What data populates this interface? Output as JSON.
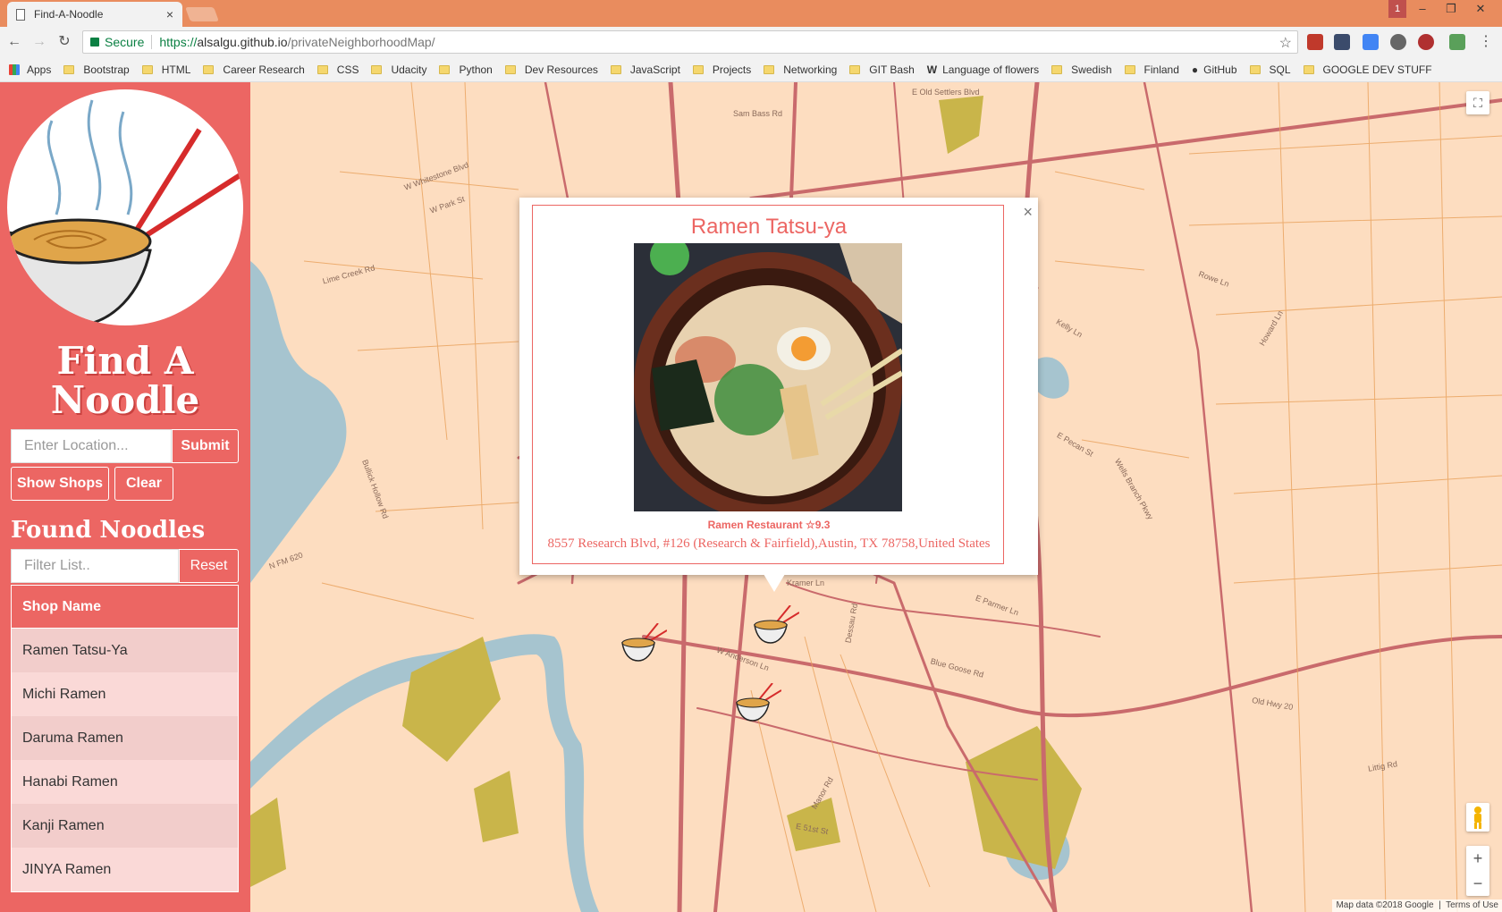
{
  "browser": {
    "tab_title": "Find-A-Noodle",
    "tab_close": "×",
    "window_badge": "1",
    "secure_label": "Secure",
    "url_scheme": "https://",
    "url_host": "alsalgu.github.io",
    "url_path": "/privateNeighborhoodMap/",
    "bookmarks": [
      "Apps",
      "Bootstrap",
      "HTML",
      "Career Research",
      "CSS",
      "Udacity",
      "Python",
      "Dev Resources",
      "JavaScript",
      "Projects",
      "Networking",
      "GIT Bash",
      "Language of flowers",
      "Swedish",
      "Finland",
      "GitHub",
      "SQL",
      "GOOGLE DEV STUFF"
    ]
  },
  "sidebar": {
    "title_line1": "Find A",
    "title_line2": "Noodle",
    "location_placeholder": "Enter Location...",
    "submit_label": "Submit",
    "show_shops_label": "Show Shops",
    "clear_label": "Clear",
    "found_title": "Found Noodles",
    "filter_placeholder": "Filter List..",
    "reset_label": "Reset",
    "table_header": "Shop Name",
    "shops": [
      "Ramen Tatsu-Ya",
      "Michi Ramen",
      "Daruma Ramen",
      "Hanabi Ramen",
      "Kanji Ramen",
      "JINYA Ramen"
    ]
  },
  "map": {
    "attribution_data": "Map data ©2018 Google",
    "attribution_terms": "Terms of Use",
    "zoom_in": "+",
    "zoom_out": "−",
    "road_labels": [
      "E Old Settlers Blvd",
      "Sam Bass Rd",
      "W Whitestone Blvd",
      "W Park St",
      "Lime Creek Rd",
      "Kramer Ln",
      "W Anderson Ln",
      "Dessau Rd",
      "Blue Goose Rd",
      "Old Hwy 20",
      "Rowe Ln",
      "Kelly Ln",
      "E Pecan St",
      "N FM 620",
      "Bullick Hollow Rd",
      "E 51st St",
      "Littig Rd",
      "E Parmer Ln",
      "Howard Ln",
      "Wells Branch Pkwy",
      "Manor Rd"
    ]
  },
  "infowindow": {
    "title": "Ramen Tatsu-ya",
    "meta": "Ramen Restaurant ☆9.3",
    "address": "8557 Research Blvd, #126 (Research & Fairfield),Austin, TX 78758,United States",
    "close": "×"
  },
  "colors": {
    "accent": "#ec6663",
    "map_land": "#fdddc0",
    "map_water": "#a6c4cf",
    "map_road": "#c96a6c",
    "map_park": "#c9b54a"
  }
}
